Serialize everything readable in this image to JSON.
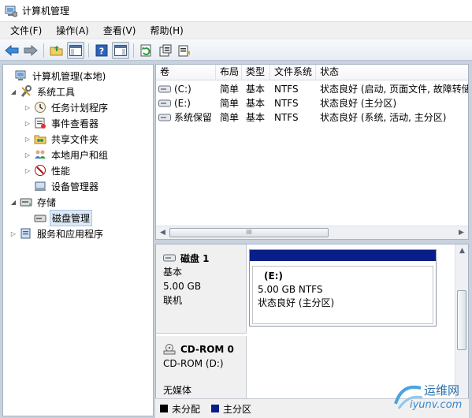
{
  "window": {
    "title": "计算机管理"
  },
  "menu": [
    "文件(F)",
    "操作(A)",
    "查看(V)",
    "帮助(H)"
  ],
  "toolbar": [
    "back-icon",
    "forward-icon",
    "up-folder-icon",
    "show-hide-tree-icon",
    "help-icon",
    "show-hide-action-pane-icon",
    "refresh-icon",
    "properties-icon",
    "export-list-icon"
  ],
  "tree": [
    {
      "label": "计算机管理(本地)",
      "level": 0,
      "expander": "",
      "icon": "computer-management-icon"
    },
    {
      "label": "系统工具",
      "level": 1,
      "expander": "◢",
      "icon": "system-tools-icon"
    },
    {
      "label": "任务计划程序",
      "level": 2,
      "expander": "▷",
      "icon": "task-scheduler-icon"
    },
    {
      "label": "事件查看器",
      "level": 2,
      "expander": "▷",
      "icon": "event-viewer-icon"
    },
    {
      "label": "共享文件夹",
      "level": 2,
      "expander": "▷",
      "icon": "shared-folders-icon"
    },
    {
      "label": "本地用户和组",
      "level": 2,
      "expander": "▷",
      "icon": "local-users-groups-icon"
    },
    {
      "label": "性能",
      "level": 2,
      "expander": "▷",
      "icon": "performance-icon"
    },
    {
      "label": "设备管理器",
      "level": 2,
      "expander": "",
      "icon": "device-manager-icon"
    },
    {
      "label": "存储",
      "level": 1,
      "expander": "◢",
      "icon": "storage-icon"
    },
    {
      "label": "磁盘管理",
      "level": 2,
      "expander": "",
      "icon": "disk-management-icon",
      "selected": true
    },
    {
      "label": "服务和应用程序",
      "level": 1,
      "expander": "▷",
      "icon": "services-applications-icon"
    }
  ],
  "volumes": {
    "columns": [
      "卷",
      "布局",
      "类型",
      "文件系统",
      "状态"
    ],
    "rows": [
      [
        "(C:)",
        "简单",
        "基本",
        "NTFS",
        "状态良好 (启动, 页面文件, 故障转储"
      ],
      [
        "(E:)",
        "简单",
        "基本",
        "NTFS",
        "状态良好 (主分区)"
      ],
      [
        "系统保留",
        "简单",
        "基本",
        "NTFS",
        "状态良好 (系统, 活动, 主分区)"
      ]
    ]
  },
  "disks": [
    {
      "name": "磁盘 1",
      "type": "基本",
      "size": "5.00 GB",
      "status": "联机",
      "partition": {
        "name": "(E:)",
        "size_fs": "5.00 GB NTFS",
        "status": "状态良好 (主分区)"
      }
    },
    {
      "name": "CD-ROM 0",
      "type": "CD-ROM (D:)",
      "status": "无媒体"
    }
  ],
  "legend": [
    {
      "label": "未分配",
      "color": "#000000"
    },
    {
      "label": "主分区",
      "color": "#0a1e87"
    }
  ],
  "watermark": {
    "cn": "运维网",
    "en": "iyunv.com"
  },
  "scroll_grip": "III"
}
